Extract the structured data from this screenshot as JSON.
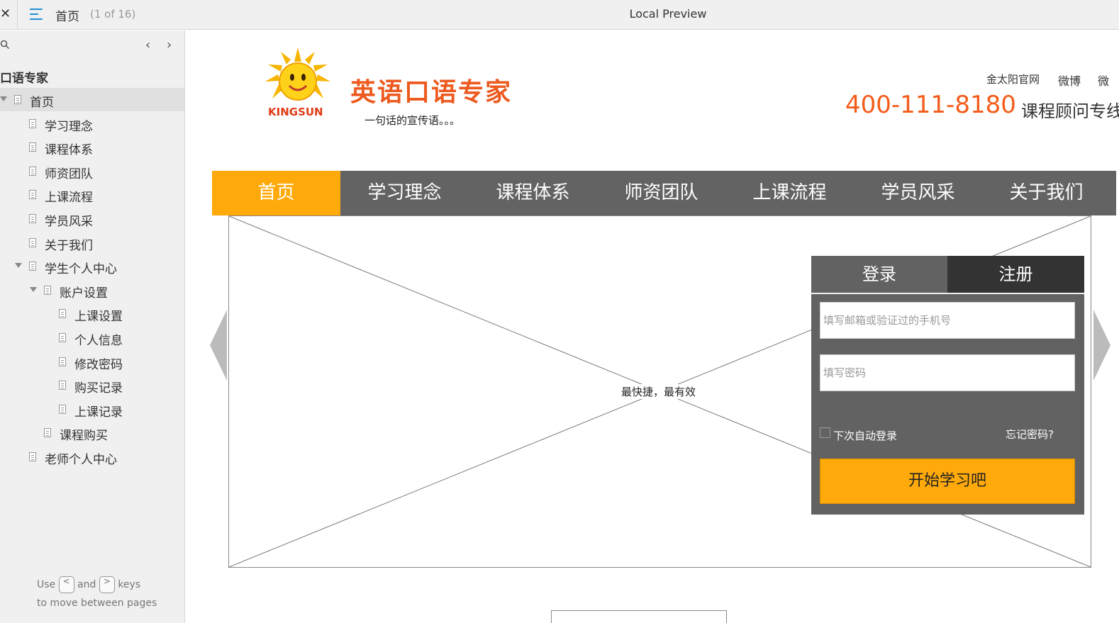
{
  "window": {
    "close_glyph": "✕",
    "title": "Local Preview",
    "current_page": "首页",
    "page_count": "(1 of 16)"
  },
  "sidebar": {
    "prev_glyph": "‹",
    "next_glyph": "›",
    "project_title": "口语专家",
    "items": [
      {
        "label": "首页",
        "level": 0,
        "expanded": true,
        "active": true
      },
      {
        "label": "学习理念",
        "level": 1
      },
      {
        "label": "课程体系",
        "level": 1
      },
      {
        "label": "师资团队",
        "level": 1
      },
      {
        "label": "上课流程",
        "level": 1
      },
      {
        "label": "学员风采",
        "level": 1
      },
      {
        "label": "关于我们",
        "level": 1
      },
      {
        "label": "学生个人中心",
        "level": 1,
        "expanded": true
      },
      {
        "label": "账户设置",
        "level": 2,
        "expanded": true
      },
      {
        "label": "上课设置",
        "level": 3
      },
      {
        "label": "个人信息",
        "level": 3
      },
      {
        "label": "修改密码",
        "level": 3
      },
      {
        "label": "购买记录",
        "level": 3
      },
      {
        "label": "上课记录",
        "level": 3
      },
      {
        "label": "课程购买",
        "level": 2
      },
      {
        "label": "老师个人中心",
        "level": 1
      }
    ],
    "hint": {
      "use": "Use",
      "prev_key": "<",
      "and": "and",
      "next_key": ">",
      "keys": "keys",
      "line2": "to move between pages"
    }
  },
  "site": {
    "logo_text": "KINGSUN",
    "brand_name": "英语口语专家",
    "slogan": "一句话的宣传语。。。",
    "top_links": [
      "金太阳官网",
      "微博",
      "微"
    ],
    "phone": "400-111-8180",
    "consult_label": "课程顾问专线",
    "nav": [
      "首页",
      "学习理念",
      "课程体系",
      "师资团队",
      "上课流程",
      "学员风采",
      "关于我们"
    ],
    "banner_text": "最快捷，最有效",
    "login": {
      "tab_login": "登录",
      "tab_register": "注册",
      "account_placeholder": "填写邮箱或验证过的手机号",
      "password_placeholder": "填写密码",
      "remember_label": "下次自动登录",
      "forgot_label": "忘记密码?",
      "submit_label": "开始学习吧"
    }
  },
  "colors": {
    "accent": "#ffaa0a",
    "nav_bg": "#636363",
    "phone": "#f35c1a",
    "brand": "#ed5a1f",
    "link_blue": "#1f8ed6"
  }
}
